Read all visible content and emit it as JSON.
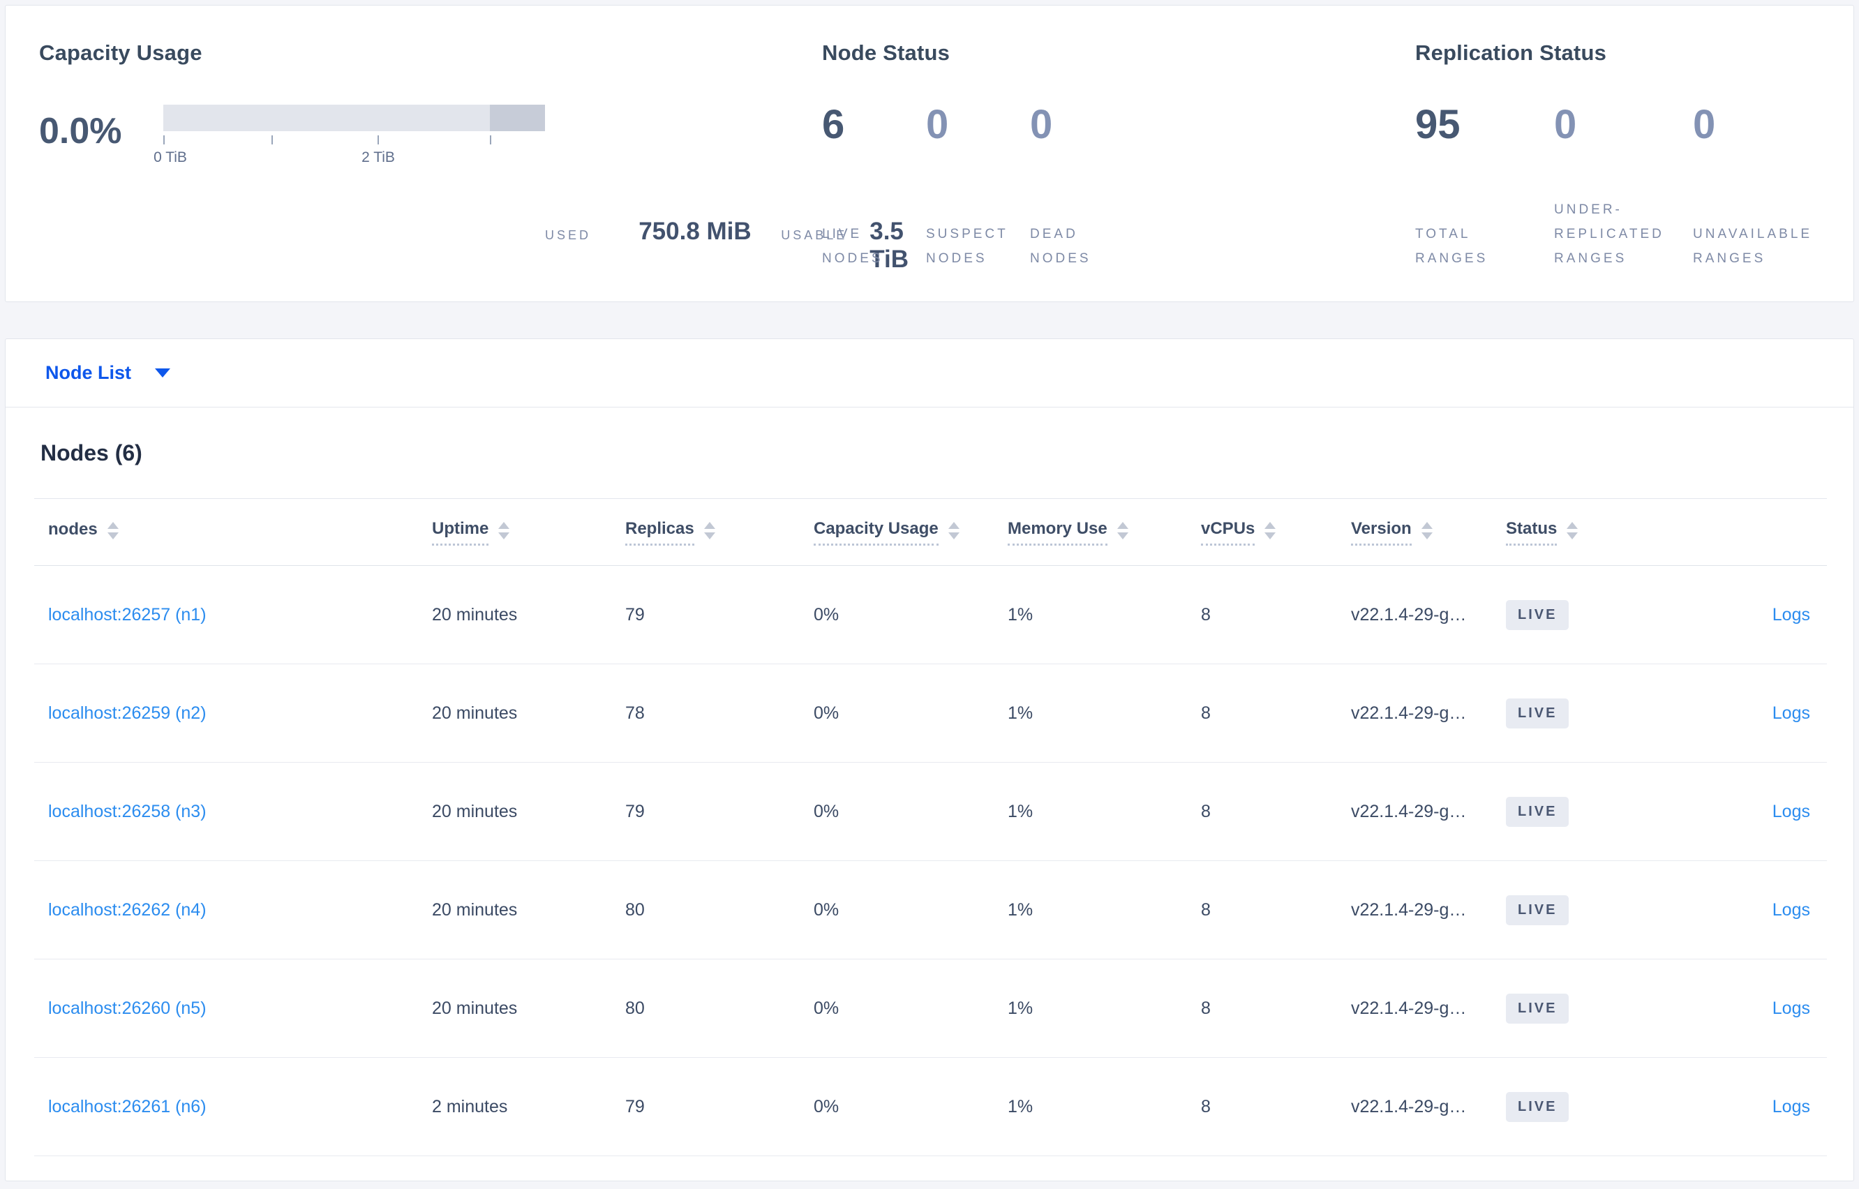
{
  "capacity": {
    "title": "Capacity Usage",
    "percent": "0.0%",
    "ticks": [
      "0 TiB",
      "2 TiB"
    ],
    "used_label": "USED",
    "used_value": "750.8 MiB",
    "usable_label": "USABLE",
    "usable_value": "3.5 TiB"
  },
  "node_status": {
    "title": "Node Status",
    "metrics": [
      {
        "value": "6",
        "label": "LIVE NODES"
      },
      {
        "value": "0",
        "label": "SUSPECT NODES"
      },
      {
        "value": "0",
        "label": "DEAD NODES"
      }
    ]
  },
  "replication": {
    "title": "Replication Status",
    "metrics": [
      {
        "value": "95",
        "label": "TOTAL RANGES"
      },
      {
        "value": "0",
        "label": "UNDER-REPLICATED RANGES"
      },
      {
        "value": "0",
        "label": "UNAVAILABLE RANGES"
      }
    ]
  },
  "node_list": {
    "dropdown_label": "Node List",
    "heading": "Nodes (6)"
  },
  "table": {
    "columns": [
      {
        "label": "nodes"
      },
      {
        "label": "Uptime"
      },
      {
        "label": "Replicas"
      },
      {
        "label": "Capacity Usage"
      },
      {
        "label": "Memory Use"
      },
      {
        "label": "vCPUs"
      },
      {
        "label": "Version"
      },
      {
        "label": "Status"
      }
    ],
    "rows": [
      {
        "address": "localhost:26257 (n1)",
        "uptime": "20 minutes",
        "replicas": "79",
        "capacity_usage": "0%",
        "memory_use": "1%",
        "vcpus": "8",
        "version": "v22.1.4-29-g…",
        "status": "LIVE",
        "logs": "Logs"
      },
      {
        "address": "localhost:26259 (n2)",
        "uptime": "20 minutes",
        "replicas": "78",
        "capacity_usage": "0%",
        "memory_use": "1%",
        "vcpus": "8",
        "version": "v22.1.4-29-g…",
        "status": "LIVE",
        "logs": "Logs"
      },
      {
        "address": "localhost:26258 (n3)",
        "uptime": "20 minutes",
        "replicas": "79",
        "capacity_usage": "0%",
        "memory_use": "1%",
        "vcpus": "8",
        "version": "v22.1.4-29-g…",
        "status": "LIVE",
        "logs": "Logs"
      },
      {
        "address": "localhost:26262 (n4)",
        "uptime": "20 minutes",
        "replicas": "80",
        "capacity_usage": "0%",
        "memory_use": "1%",
        "vcpus": "8",
        "version": "v22.1.4-29-g…",
        "status": "LIVE",
        "logs": "Logs"
      },
      {
        "address": "localhost:26260 (n5)",
        "uptime": "20 minutes",
        "replicas": "80",
        "capacity_usage": "0%",
        "memory_use": "1%",
        "vcpus": "8",
        "version": "v22.1.4-29-g…",
        "status": "LIVE",
        "logs": "Logs"
      },
      {
        "address": "localhost:26261 (n6)",
        "uptime": "2 minutes",
        "replicas": "79",
        "capacity_usage": "0%",
        "memory_use": "1%",
        "vcpus": "8",
        "version": "v22.1.4-29-g…",
        "status": "LIVE",
        "logs": "Logs"
      }
    ]
  }
}
